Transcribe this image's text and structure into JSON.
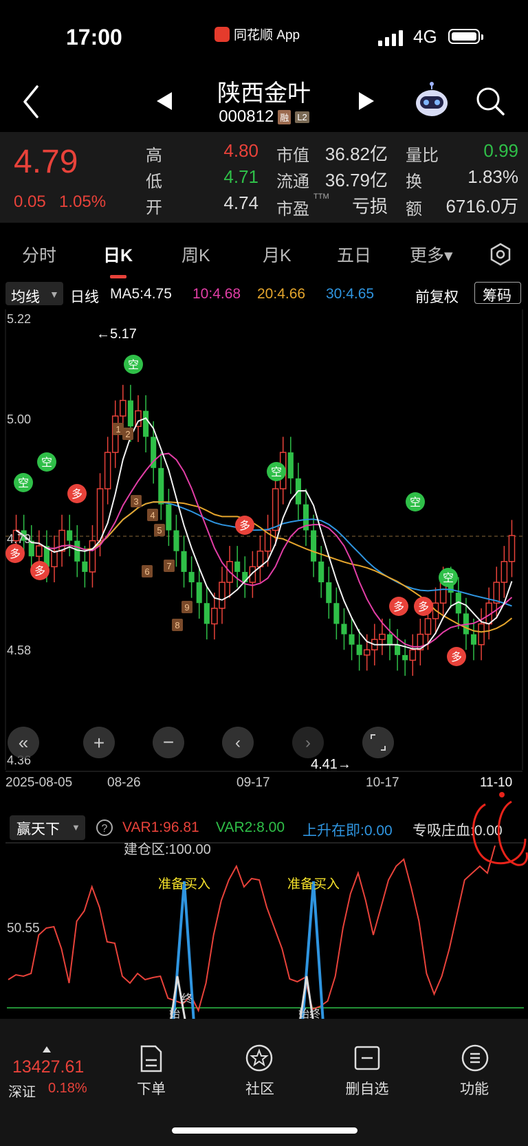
{
  "status": {
    "time": "17:00",
    "app": "同花顺 App",
    "network": "4G",
    "battery": 1.0
  },
  "header": {
    "stock_name": "陕西金叶",
    "stock_code": "000812",
    "tag_rong": "融",
    "tag_l2": "L2"
  },
  "quote": {
    "price": "4.79",
    "change": "0.05",
    "change_pct": "1.05%",
    "high_label": "高",
    "high": "4.80",
    "low_label": "低",
    "low": "4.71",
    "open_label": "开",
    "open": "4.74",
    "mcap_label": "市值",
    "mcap": "36.82亿",
    "float_label": "流通",
    "float": "36.79亿",
    "pe_label": "市盈",
    "pe_sup": "TTM",
    "pe": "亏损",
    "vr_label": "量比",
    "vr": "0.99",
    "turn_label": "换",
    "turn": "1.83%",
    "amt_label": "额",
    "amt": "6716.0万"
  },
  "tabs": [
    "分时",
    "日K",
    "周K",
    "月K",
    "五日",
    "更多▾"
  ],
  "active_tab": "日K",
  "ma_bar": {
    "selector": "均线",
    "line": "日线",
    "ma5": "MA5:4.75",
    "ma10": "10:4.68",
    "ma20": "20:4.66",
    "ma30": "30:4.65",
    "adjust": "前复权",
    "chouma": "筹码"
  },
  "colors": {
    "up": "#e8423a",
    "down": "#2fbf48",
    "ma5": "#f2f2f2",
    "ma10": "#e23ea6",
    "ma20": "#e5a52c",
    "ma30": "#2f95e0",
    "accent_red": "#e8423a"
  },
  "kline": {
    "y_labels": [
      "5.22",
      "5.00",
      "4.79",
      "4.58",
      "4.36"
    ],
    "x_labels": [
      "2025-08-05",
      "08-26",
      "09-17",
      "10-17",
      "11-10"
    ],
    "high_note": "←5.17",
    "low_note": "4.41→"
  },
  "indicator": {
    "name": "赢天下",
    "var1": "VAR1:96.81",
    "var2": "VAR2:8.00",
    "up": "上升在即:0.00",
    "zhuang": "专吸庄血:0.00",
    "build": "建仓区:100.00",
    "y_label": "50.55",
    "ready": "准备买入",
    "start": "始",
    "end": "终"
  },
  "bottom": {
    "index_value": "13427.61",
    "index_name": "深证",
    "index_pct": "0.18%",
    "nav": [
      "下单",
      "社区",
      "删自选",
      "功能"
    ]
  }
}
